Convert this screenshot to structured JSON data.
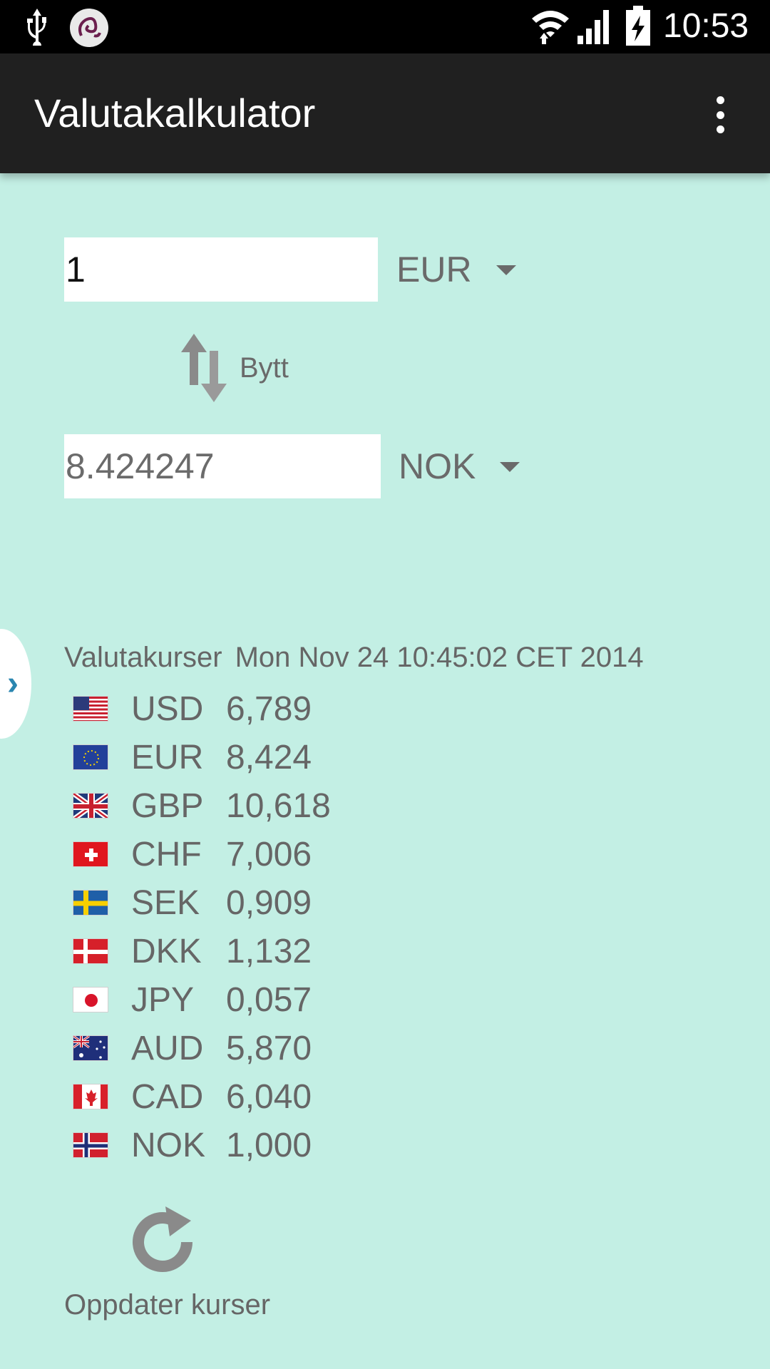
{
  "status_bar": {
    "time": "10:53",
    "icons": [
      "usb-icon",
      "app-notification-icon",
      "wifi-icon",
      "cell-signal-icon",
      "battery-charging-icon"
    ]
  },
  "action_bar": {
    "title": "Valutakalkulator",
    "overflow_icon": "more-vert-icon"
  },
  "converter": {
    "from_amount": "1",
    "from_currency": "EUR",
    "swap_label": "Bytt",
    "to_amount": "8.424247",
    "to_currency": "NOK"
  },
  "rates": {
    "header": "Valutakurser",
    "timestamp": "Mon Nov 24 10:45:02 CET 2014",
    "items": [
      {
        "code": "USD",
        "value": "6,789",
        "flag": "us-flag-icon"
      },
      {
        "code": "EUR",
        "value": "8,424",
        "flag": "eu-flag-icon"
      },
      {
        "code": "GBP",
        "value": "10,618",
        "flag": "gb-flag-icon"
      },
      {
        "code": "CHF",
        "value": "7,006",
        "flag": "ch-flag-icon"
      },
      {
        "code": "SEK",
        "value": "0,909",
        "flag": "se-flag-icon"
      },
      {
        "code": "DKK",
        "value": "1,132",
        "flag": "dk-flag-icon"
      },
      {
        "code": "JPY",
        "value": "0,057",
        "flag": "jp-flag-icon"
      },
      {
        "code": "AUD",
        "value": "5,870",
        "flag": "au-flag-icon"
      },
      {
        "code": "CAD",
        "value": "6,040",
        "flag": "ca-flag-icon"
      },
      {
        "code": "NOK",
        "value": "1,000",
        "flag": "no-flag-icon"
      }
    ]
  },
  "refresh": {
    "label": "Oppdater kurser"
  },
  "colors": {
    "background": "#c3efe4",
    "action_bar": "#202020",
    "text_gray": "#666666",
    "drawer_chevron": "#2a86b0"
  }
}
